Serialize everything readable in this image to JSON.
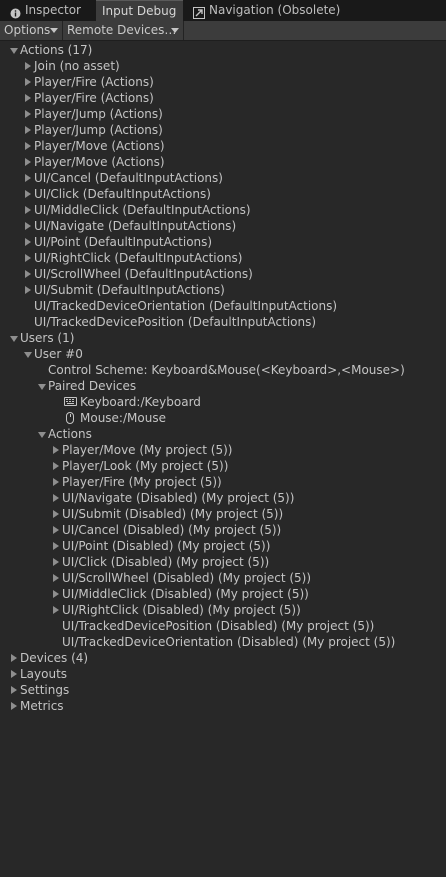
{
  "tabs": [
    {
      "label": "Inspector",
      "icon": "info-icon",
      "active": false
    },
    {
      "label": "Input Debug",
      "icon": "",
      "active": true
    },
    {
      "label": "Navigation (Obsolete)",
      "icon": "navigation-icon",
      "active": false
    }
  ],
  "toolbar": {
    "options_label": "Options",
    "remote_label": "Remote Devices…"
  },
  "tree": [
    {
      "depth": 0,
      "fold": "open",
      "label": "Actions (17)"
    },
    {
      "depth": 1,
      "fold": "closed",
      "label": "Join (no asset)"
    },
    {
      "depth": 1,
      "fold": "closed",
      "label": "Player/Fire (Actions)"
    },
    {
      "depth": 1,
      "fold": "closed",
      "label": "Player/Fire (Actions)"
    },
    {
      "depth": 1,
      "fold": "closed",
      "label": "Player/Jump (Actions)"
    },
    {
      "depth": 1,
      "fold": "closed",
      "label": "Player/Jump (Actions)"
    },
    {
      "depth": 1,
      "fold": "closed",
      "label": "Player/Move (Actions)"
    },
    {
      "depth": 1,
      "fold": "closed",
      "label": "Player/Move (Actions)"
    },
    {
      "depth": 1,
      "fold": "closed",
      "label": "UI/Cancel (DefaultInputActions)"
    },
    {
      "depth": 1,
      "fold": "closed",
      "label": "UI/Click (DefaultInputActions)"
    },
    {
      "depth": 1,
      "fold": "closed",
      "label": "UI/MiddleClick (DefaultInputActions)"
    },
    {
      "depth": 1,
      "fold": "closed",
      "label": "UI/Navigate (DefaultInputActions)"
    },
    {
      "depth": 1,
      "fold": "closed",
      "label": "UI/Point (DefaultInputActions)"
    },
    {
      "depth": 1,
      "fold": "closed",
      "label": "UI/RightClick (DefaultInputActions)"
    },
    {
      "depth": 1,
      "fold": "closed",
      "label": "UI/ScrollWheel (DefaultInputActions)"
    },
    {
      "depth": 1,
      "fold": "closed",
      "label": "UI/Submit (DefaultInputActions)"
    },
    {
      "depth": 1,
      "fold": "none",
      "label": "UI/TrackedDeviceOrientation (DefaultInputActions)"
    },
    {
      "depth": 1,
      "fold": "none",
      "label": "UI/TrackedDevicePosition (DefaultInputActions)"
    },
    {
      "depth": 0,
      "fold": "open",
      "label": "Users (1)"
    },
    {
      "depth": 1,
      "fold": "open",
      "label": "User #0"
    },
    {
      "depth": 2,
      "fold": "none",
      "label": "Control Scheme: Keyboard&Mouse(<Keyboard>,<Mouse>)"
    },
    {
      "depth": 2,
      "fold": "open",
      "label": "Paired Devices"
    },
    {
      "depth": 3,
      "fold": "none",
      "label": "Keyboard:/Keyboard",
      "icon": "keyboard-icon"
    },
    {
      "depth": 3,
      "fold": "none",
      "label": "Mouse:/Mouse",
      "icon": "mouse-icon"
    },
    {
      "depth": 2,
      "fold": "open",
      "label": "Actions"
    },
    {
      "depth": 3,
      "fold": "closed",
      "label": "Player/Move (My project (5))"
    },
    {
      "depth": 3,
      "fold": "closed",
      "label": "Player/Look (My project (5))"
    },
    {
      "depth": 3,
      "fold": "closed",
      "label": "Player/Fire (My project (5))"
    },
    {
      "depth": 3,
      "fold": "closed",
      "label": "UI/Navigate (Disabled) (My project (5))"
    },
    {
      "depth": 3,
      "fold": "closed",
      "label": "UI/Submit (Disabled) (My project (5))"
    },
    {
      "depth": 3,
      "fold": "closed",
      "label": "UI/Cancel (Disabled) (My project (5))"
    },
    {
      "depth": 3,
      "fold": "closed",
      "label": "UI/Point (Disabled) (My project (5))"
    },
    {
      "depth": 3,
      "fold": "closed",
      "label": "UI/Click (Disabled) (My project (5))"
    },
    {
      "depth": 3,
      "fold": "closed",
      "label": "UI/ScrollWheel (Disabled) (My project (5))"
    },
    {
      "depth": 3,
      "fold": "closed",
      "label": "UI/MiddleClick (Disabled) (My project (5))"
    },
    {
      "depth": 3,
      "fold": "closed",
      "label": "UI/RightClick (Disabled) (My project (5))"
    },
    {
      "depth": 3,
      "fold": "none",
      "label": "UI/TrackedDevicePosition (Disabled) (My project (5))"
    },
    {
      "depth": 3,
      "fold": "none",
      "label": "UI/TrackedDeviceOrientation (Disabled) (My project (5))"
    },
    {
      "depth": 0,
      "fold": "closed",
      "label": "Devices (4)"
    },
    {
      "depth": 0,
      "fold": "closed",
      "label": "Layouts"
    },
    {
      "depth": 0,
      "fold": "closed",
      "label": "Settings"
    },
    {
      "depth": 0,
      "fold": "closed",
      "label": "Metrics"
    }
  ]
}
